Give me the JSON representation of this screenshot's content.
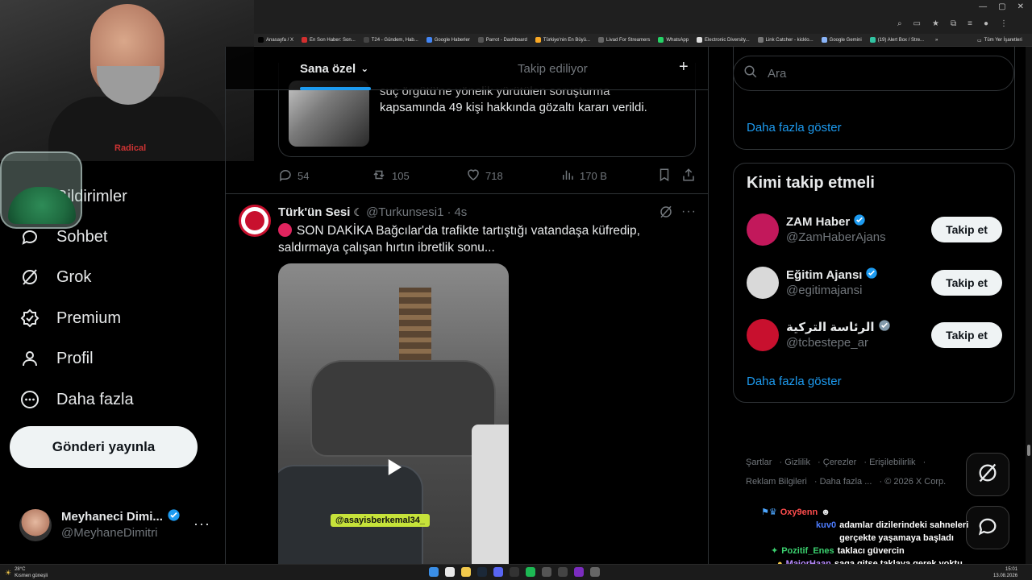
{
  "browser": {
    "bookmarks": [
      {
        "label": "Anasayfa / X",
        "color": "#000000"
      },
      {
        "label": "En Son Haber: Son...",
        "color": "#d32f2f"
      },
      {
        "label": "T24 - Gündem, Hab...",
        "color": "#444444"
      },
      {
        "label": "Google Haberler",
        "color": "#4285f4"
      },
      {
        "label": "Parrot - Dashboard",
        "color": "#555555"
      },
      {
        "label": "Türkiye'nin En Büyü...",
        "color": "#f9a825"
      },
      {
        "label": "Livad For Streamers",
        "color": "#666666"
      },
      {
        "label": "WhatsApp",
        "color": "#25d366"
      },
      {
        "label": "Electronic Diversity...",
        "color": "#dddddd"
      },
      {
        "label": "Link Catcher - kicklo...",
        "color": "#777777"
      },
      {
        "label": "Google Gemini",
        "color": "#8ab4f8"
      },
      {
        "label": "(19) Alert Box / Stre...",
        "color": "#31c3a2"
      }
    ],
    "bookmarks_more": "»",
    "bookmarks_all": "Tüm Yer İşaretleri"
  },
  "webcam": {
    "shirt_text": "Radical"
  },
  "sidebar": {
    "items": [
      {
        "label": "Bildirimler",
        "icon": "bell-icon"
      },
      {
        "label": "Sohbet",
        "icon": "chat-icon"
      },
      {
        "label": "Grok",
        "icon": "grok-icon"
      },
      {
        "label": "Premium",
        "icon": "premium-icon"
      },
      {
        "label": "Profil",
        "icon": "profile-icon"
      },
      {
        "label": "Daha fazla",
        "icon": "more-circle-icon"
      }
    ],
    "post_button": "Gönderi yayınla",
    "account": {
      "name": "Meyhaneci Dimi...",
      "handle": "@MeyhaneDimitri",
      "more": "···"
    }
  },
  "feed": {
    "tabs": {
      "for_you": "Sana özel",
      "following": "Takip ediliyor",
      "plus": "+"
    },
    "quoted": {
      "text_partial": "suç örgütü'ne yönelik yürütülen soruşturma",
      "text": "kapsamında 49 kişi hakkında gözaltı kararı verildi."
    },
    "actions": {
      "replies": "54",
      "reposts": "105",
      "likes": "718",
      "views": "170 B"
    },
    "tweet": {
      "name": "Türk'ün Sesi",
      "handle": "@Turkunsesi1",
      "sep": "·",
      "time": "4s",
      "text": "SON DAKİKA Bağcılar'da trafikte tartıştığı vatandaşa küfredip, saldırmaya çalışan hırtın ibretlik sonu...",
      "video_tag": "@asayisberkemal34_"
    }
  },
  "right": {
    "search_placeholder": "Ara",
    "show_more": "Daha fazla göster",
    "who_to_follow_title": "Kimi takip etmeli",
    "suggestions": [
      {
        "name": "ZAM Haber",
        "handle": "@ZamHaberAjans",
        "button": "Takip et",
        "avatar_color": "#c2185b"
      },
      {
        "name": "Eğitim Ajansı",
        "handle": "@egitimajansi",
        "button": "Takip et",
        "avatar_color": "#d9d9d9"
      },
      {
        "name": "الرئاسة التركية",
        "handle": "@tcbestepe_ar",
        "button": "Takip et",
        "avatar_color": "#c8102e"
      }
    ],
    "show_more_2": "Daha fazla göster",
    "footer": [
      "Şartlar",
      "Gizlilik",
      "Çerezler",
      "Erişilebilirlik",
      "Reklam Bilgileri",
      "Daha fazla ...",
      "© 2026 X Corp."
    ]
  },
  "chat": [
    {
      "user": "Oxy9enn",
      "msg": "",
      "color": "#ff4d4d"
    },
    {
      "user": "kuv0",
      "msg": "adamlar dizilerindeki sahneleri gerçekte yaşamaya başladı",
      "color": "#4d7dff"
    },
    {
      "user": "Pozitif_Enes",
      "msg": "taklacı güvercin",
      "color": "#3bd16f"
    },
    {
      "user": "MajorHaan",
      "msg": "saga gitse taklaya gerek yoktu",
      "color": "#b98cff"
    }
  ],
  "taskbar": {
    "temp": "28°C",
    "weather": "Kısmen güneşli",
    "time": "15:01",
    "date": "13.08.2026"
  }
}
